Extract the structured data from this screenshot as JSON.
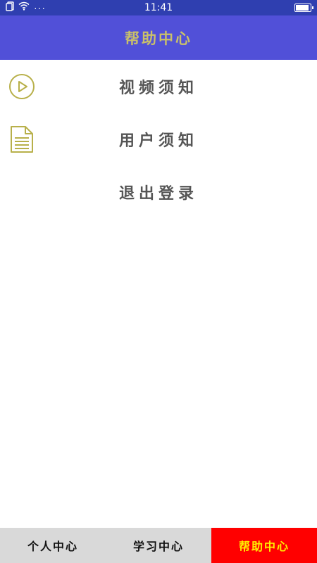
{
  "status_bar": {
    "time": "11:41",
    "dots": "···",
    "battery_level": 0.95
  },
  "header": {
    "title": "帮助中心"
  },
  "menu": {
    "items": [
      {
        "label": "视频须知",
        "icon": "play-circle-icon"
      },
      {
        "label": "用户须知",
        "icon": "document-icon"
      },
      {
        "label": "退出登录",
        "icon": ""
      }
    ]
  },
  "tabbar": {
    "tabs": [
      {
        "label": "个人中心",
        "active": false
      },
      {
        "label": "学习中心",
        "active": false
      },
      {
        "label": "帮助中心",
        "active": true
      }
    ]
  },
  "colors": {
    "status_bar": "#2f3fb0",
    "header_bg": "#5150d8",
    "header_title": "#c9c06a",
    "icon": "#b8b04a",
    "menu_text": "#555555",
    "tab_bg": "#d9d9d9",
    "tab_active_bg": "#ff0000",
    "tab_active_text": "#ffee00"
  }
}
